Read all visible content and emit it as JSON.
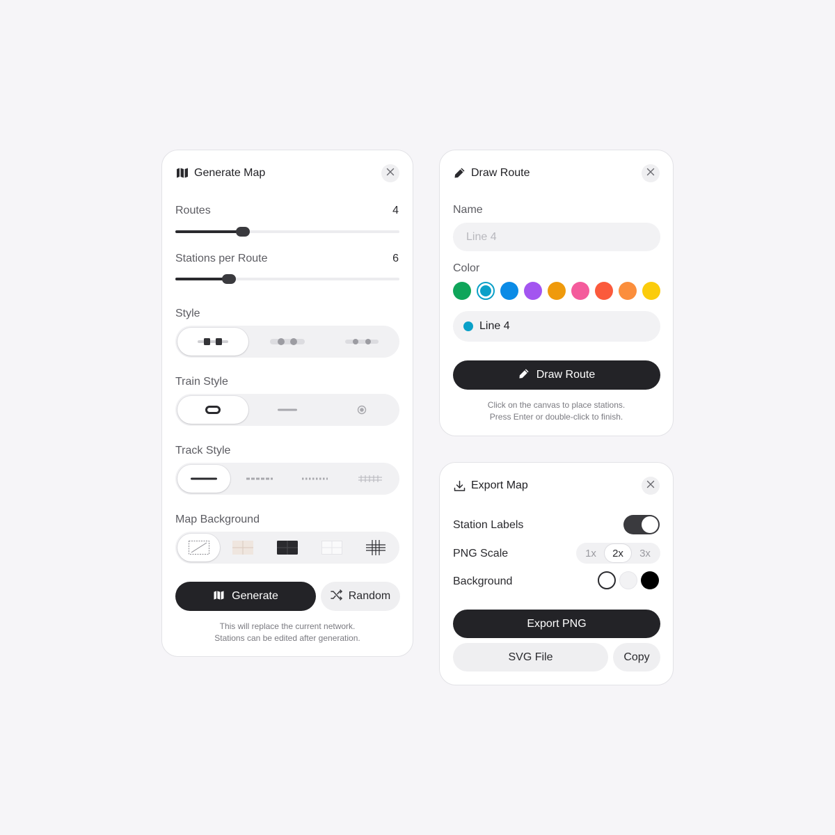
{
  "generate_panel": {
    "title": "Generate Map",
    "icon": "map-icon",
    "routes": {
      "label": "Routes",
      "value": "4",
      "fraction": 0.3
    },
    "stations": {
      "label": "Stations per Route",
      "value": "6",
      "fraction": 0.24
    },
    "style": {
      "label": "Style",
      "options": [
        "style-square-stations",
        "style-round-stations",
        "style-small-stations"
      ],
      "selected_index": 0
    },
    "train_style": {
      "label": "Train Style",
      "options": [
        "train-pill",
        "train-line",
        "train-dot"
      ],
      "selected_index": 0
    },
    "track_style": {
      "label": "Track Style",
      "options": [
        "track-solid",
        "track-dashed",
        "track-dotted",
        "track-rail"
      ],
      "selected_index": 0
    },
    "map_background": {
      "label": "Map Background",
      "options": [
        "bg-none",
        "bg-paper-grid",
        "bg-dark",
        "bg-light-grid",
        "bg-hash-grid"
      ],
      "selected_index": 0
    },
    "generate_label": "Generate",
    "random_label": "Random",
    "hint_line1": "This will replace the current network.",
    "hint_line2": "Stations can be edited after generation."
  },
  "draw_panel": {
    "title": "Draw Route",
    "icon": "pencil-icon",
    "name_label": "Name",
    "name_placeholder": "Line 4",
    "color_label": "Color",
    "colors": [
      "#0fa55a",
      "#0aa0c8",
      "#0b8be6",
      "#a355f0",
      "#ef9a0c",
      "#f45b9c",
      "#fb5a3c",
      "#fb8e3c",
      "#fbcc0c"
    ],
    "selected_color_index": 1,
    "preview_label": "Line 4",
    "preview_color": "#0aa0c8",
    "draw_button_label": "Draw Route",
    "hint_line1": "Click on the canvas to place stations.",
    "hint_line2": "Press Enter or double-click to finish."
  },
  "export_panel": {
    "title": "Export Map",
    "icon": "download-icon",
    "station_labels": {
      "label": "Station Labels",
      "enabled": true
    },
    "png_scale": {
      "label": "PNG Scale",
      "options": [
        "1x",
        "2x",
        "3x"
      ],
      "selected": "2x"
    },
    "background": {
      "label": "Background",
      "options": [
        "#ffffff",
        "#f2f2f4",
        "#000000"
      ],
      "selected_index": 0
    },
    "export_png_label": "Export PNG",
    "svg_label": "SVG File",
    "copy_label": "Copy"
  }
}
